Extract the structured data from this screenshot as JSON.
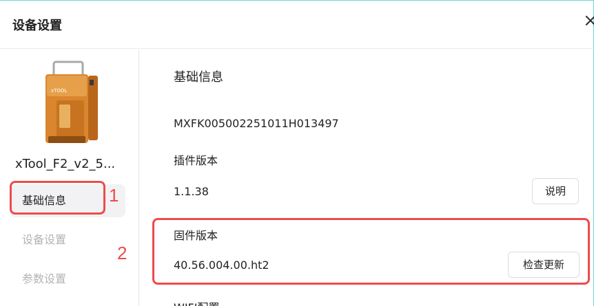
{
  "dialog": {
    "title": "设备设置",
    "close_glyph": "×"
  },
  "sidebar": {
    "device_name": "xTool_F2_v2_5...",
    "device_brand": "xTOOL",
    "items": [
      {
        "label": "基础信息",
        "active": true
      },
      {
        "label": "设备设置",
        "active": false
      },
      {
        "label": "参数设置",
        "active": false
      }
    ]
  },
  "content": {
    "section_title": "基础信息",
    "serial_number": "MXFK005002251011H013497",
    "plugin_label": "插件版本",
    "plugin_version": "1.1.38",
    "plugin_button": "说明",
    "firmware_label": "固件版本",
    "firmware_version": "40.56.004.00.ht2",
    "firmware_button": "检查更新",
    "wifi_label": "WIFI配置"
  },
  "annotations": {
    "marker_1": "1",
    "marker_2": "2",
    "color": "#ef4a4a"
  },
  "icons": {
    "close": "close-icon",
    "device": "laser-engraver-icon"
  }
}
